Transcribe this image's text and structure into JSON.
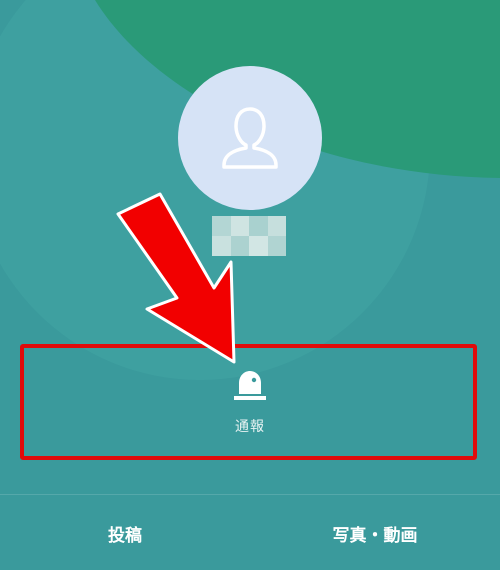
{
  "profile": {
    "avatar_icon": "person-outline-icon",
    "name_masked": ""
  },
  "action": {
    "report_icon": "siren-icon",
    "report_label": "通報"
  },
  "annotation": {
    "arrow_color": "#e00b0b",
    "box_color": "#e00b0b"
  },
  "tabs": {
    "posts_label": "投稿",
    "media_label": "写真・動画"
  },
  "colors": {
    "background": "#3a9a9c",
    "header_green": "#2a9a78",
    "avatar_bg": "#d6e3f6"
  }
}
